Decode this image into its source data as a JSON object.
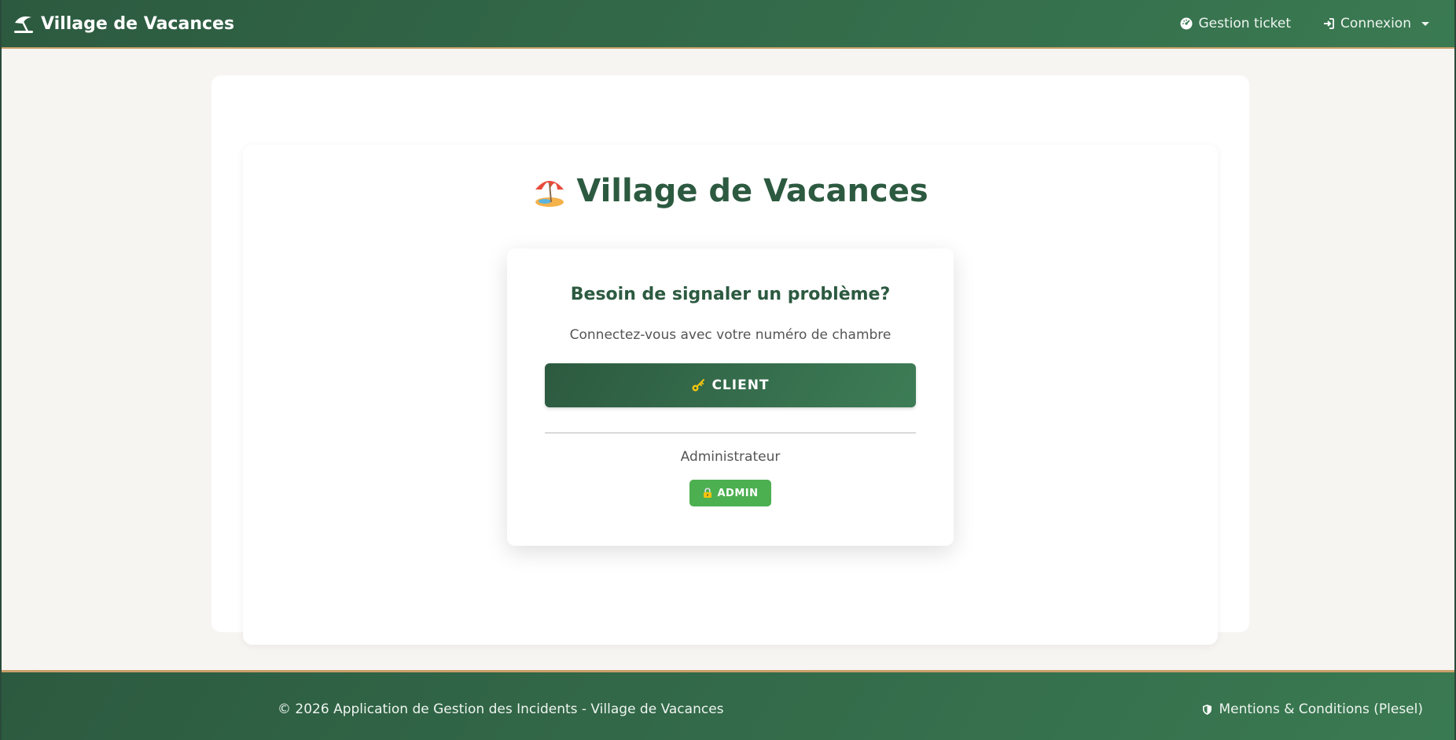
{
  "navbar": {
    "brand": "Village de Vacances",
    "brand_icon": "umbrella-beach-icon",
    "links": [
      {
        "label": "Gestion ticket",
        "icon": "gauge-icon"
      },
      {
        "label": "Connexion",
        "icon": "sign-in-icon"
      }
    ]
  },
  "main": {
    "title": "Village de Vacances",
    "title_icon": "beach-umbrella-emoji",
    "login": {
      "heading": "Besoin de signaler un problème?",
      "subtitle": "Connectez-vous avec votre numéro de chambre",
      "client_button": "CLIENT",
      "admin_label": "Administrateur",
      "admin_button": "ADMIN"
    }
  },
  "footer": {
    "copyright": "© 2026 Application de Gestion des Incidents - Village de Vacances",
    "legal_link": "Mentions & Conditions (Plesel)"
  },
  "colors": {
    "primary": "#2c5a40",
    "accent": "#c8a06a",
    "admin": "#4caf50",
    "background": "#f7f5f2"
  }
}
